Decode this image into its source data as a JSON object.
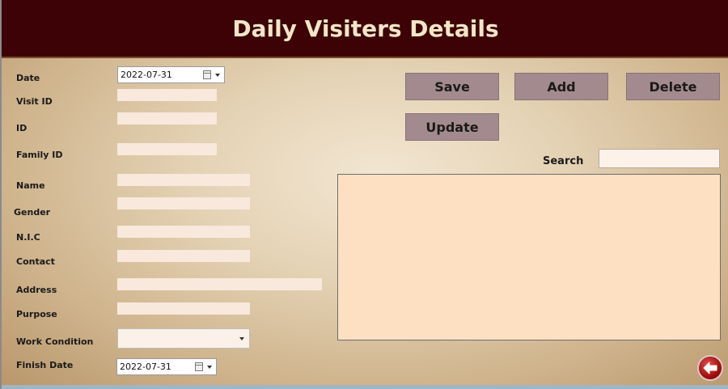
{
  "title": "Daily Visiters Details",
  "labels": {
    "date": "Date",
    "visit_id": "Visit ID",
    "id": "ID",
    "family_id": "Family ID",
    "name": "Name",
    "gender": "Gender",
    "nic": "N.I.C",
    "contact": "Contact",
    "address": "Address",
    "purpose": "Purpose",
    "work_condition": "Work Condition",
    "finish_date": "Finish Date",
    "search": "Search"
  },
  "values": {
    "date": "2022-07-31",
    "finish_date": "2022-07-31",
    "visit_id": "",
    "id": "",
    "family_id": "",
    "name": "",
    "gender": "",
    "nic": "",
    "contact": "",
    "address": "",
    "purpose": "",
    "work_condition": "",
    "search": ""
  },
  "buttons": {
    "save": "Save",
    "add": "Add",
    "delete": "Delete",
    "update": "Update"
  },
  "icons": {
    "date_picker": "calendar-icon",
    "dropdown": "chevron-down-icon",
    "back": "back-arrow-icon"
  },
  "colors": {
    "title_bar": "#3d0205",
    "title_text": "#f3e6c7",
    "button": "#a38a8e",
    "grid": "#fde0c2",
    "field": "#f9e8dc"
  }
}
